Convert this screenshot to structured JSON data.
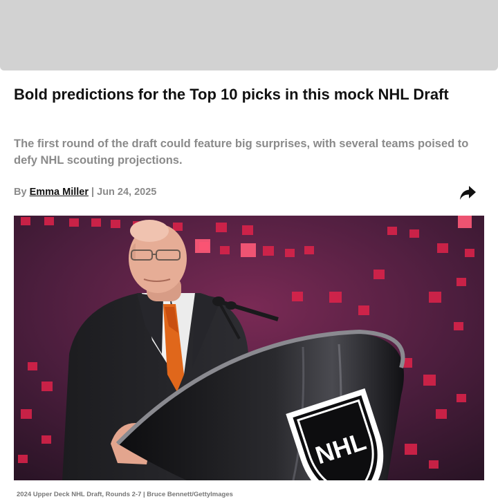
{
  "article": {
    "headline": "Bold predictions for the Top 10 picks in this mock NHL Draft",
    "subheadline": "The first round of the draft could feature big surprises, with several teams poised to defy NHL scouting projections.",
    "byline": {
      "prefix": "By",
      "author": "Emma Miller",
      "separator": "|",
      "date": "Jun 24, 2025"
    },
    "share_icon": "share-arrow-icon",
    "hero_image": {
      "logo_text": "NHL",
      "caption": "2024 Upper Deck NHL Draft, Rounds 2-7 | Bruce Bennett/GettyImages"
    }
  },
  "colors": {
    "headline": "#111111",
    "muted": "#8a8a8a",
    "ad_placeholder": "#d2d2d2"
  }
}
